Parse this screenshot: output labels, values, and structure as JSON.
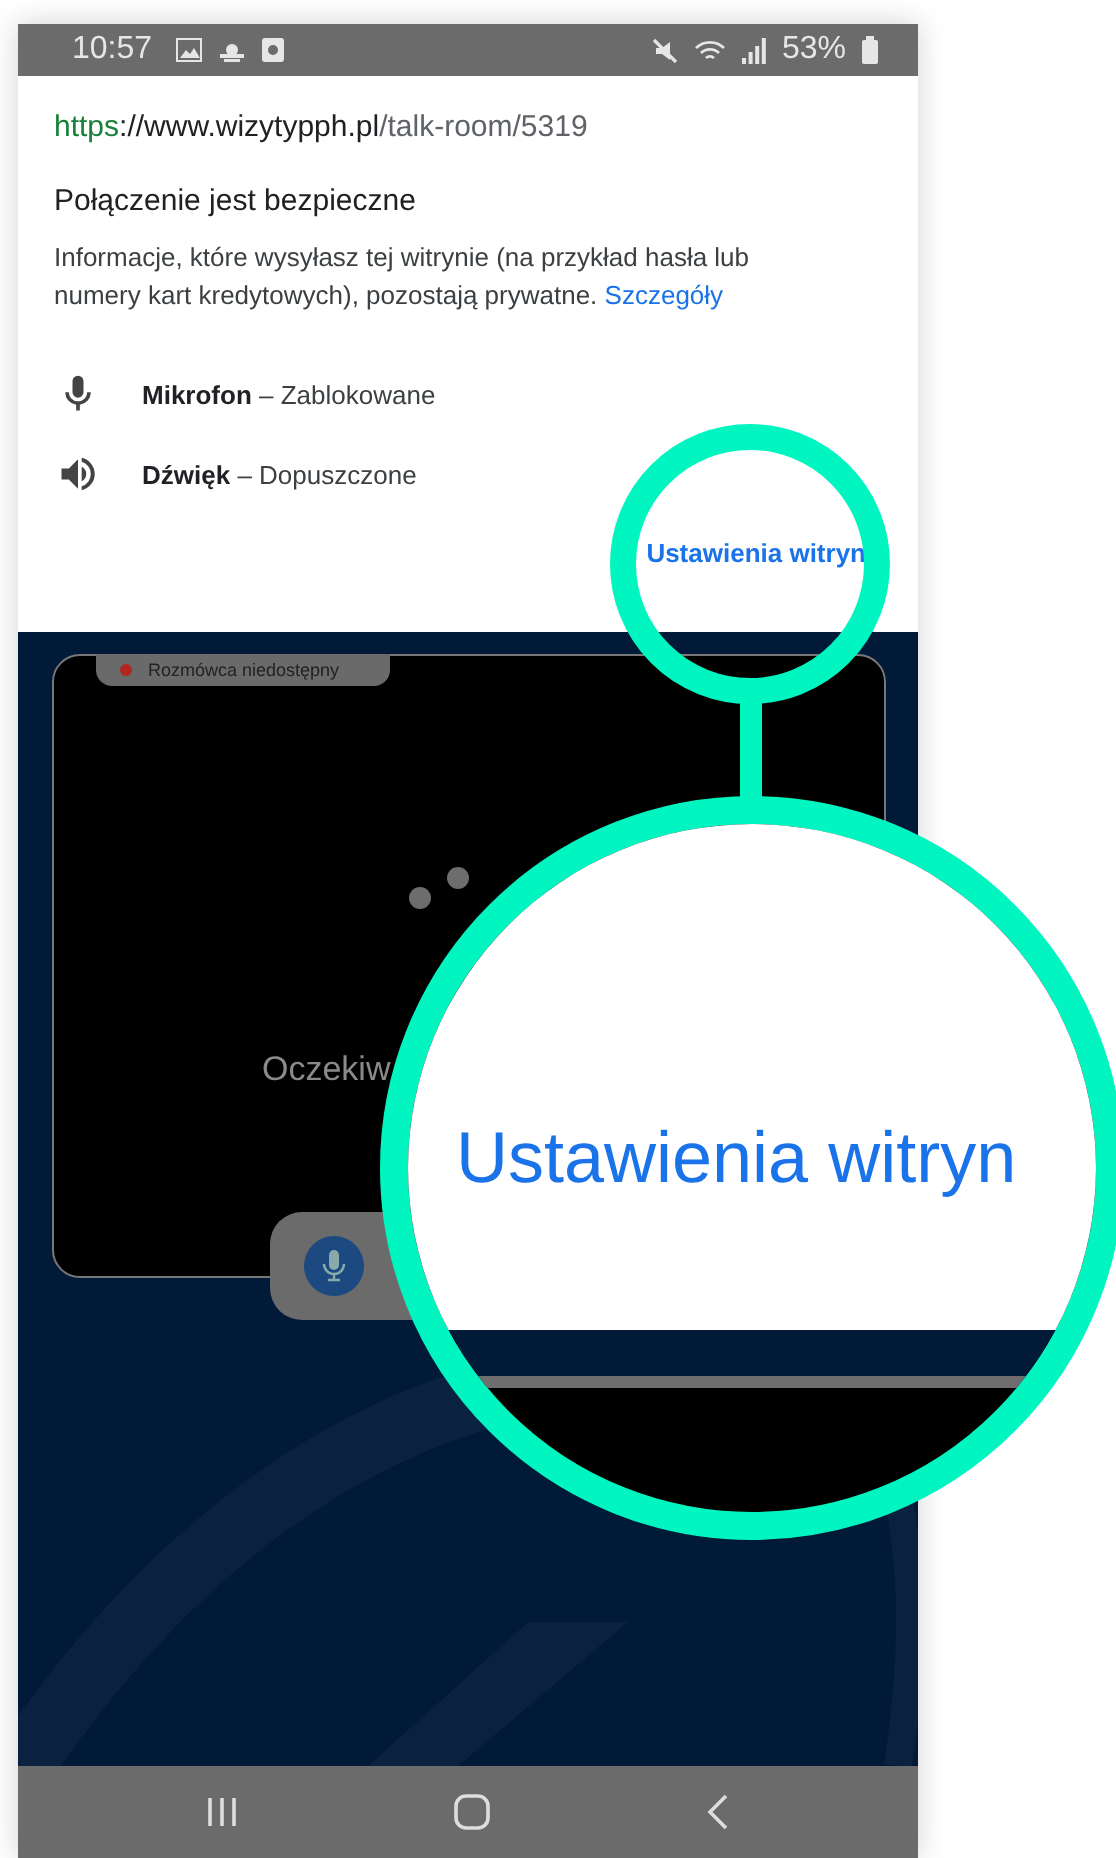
{
  "status_bar": {
    "time": "10:57",
    "battery": "53%"
  },
  "site_info": {
    "url_scheme": "https",
    "url_domain": "://www.wizytypph.pl",
    "url_path": "/talk-room/5319",
    "title": "Połączenie jest bezpieczne",
    "description": "Informacje, które wysyłasz tej witrynie (na przykład hasła lub numery kart kredytowych), pozostają prywatne.",
    "details_link": "Szczegóły",
    "permissions": [
      {
        "kind": "microphone",
        "label": "**Mikrofon** – Zablokowane"
      },
      {
        "kind": "sound",
        "label": "**Dźwięk** – Dopuszczone"
      }
    ],
    "settings_link": "Ustawienia witryn"
  },
  "video": {
    "badge": "Rozmówca niedostępny",
    "message": "Oczekiw"
  },
  "magnifier": {
    "text": "Ustawienia witryn"
  }
}
